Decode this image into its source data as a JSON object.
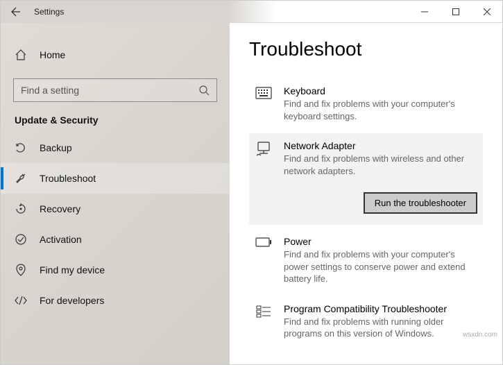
{
  "window": {
    "title": "Settings"
  },
  "sidebar": {
    "home_label": "Home",
    "search_placeholder": "Find a setting",
    "section_header": "Update & Security",
    "items": [
      {
        "label": "Backup"
      },
      {
        "label": "Troubleshoot"
      },
      {
        "label": "Recovery"
      },
      {
        "label": "Activation"
      },
      {
        "label": "Find my device"
      },
      {
        "label": "For developers"
      }
    ]
  },
  "main": {
    "page_title": "Troubleshoot",
    "run_button_label": "Run the troubleshooter",
    "troubleshooters": [
      {
        "title": "Keyboard",
        "desc": "Find and fix problems with your computer's keyboard settings."
      },
      {
        "title": "Network Adapter",
        "desc": "Find and fix problems with wireless and other network adapters."
      },
      {
        "title": "Power",
        "desc": "Find and fix problems with your computer's power settings to conserve power and extend battery life."
      },
      {
        "title": "Program Compatibility Troubleshooter",
        "desc": "Find and fix problems with running older programs on this version of Windows."
      }
    ]
  },
  "watermark": "wsxdn.com"
}
